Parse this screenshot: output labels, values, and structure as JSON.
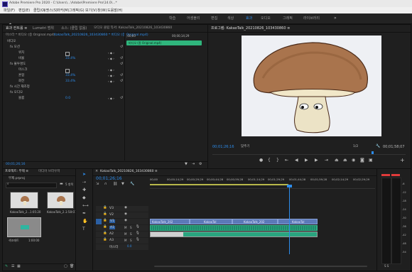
{
  "title_bar": {
    "text": "Adobe Premiere Pro 2020 - C:\\Users\\...\\Adobe\\Premiere Pro\\14.0\\...*"
  },
  "menu": [
    "파일(F)",
    "편집(E)",
    "클립(C)",
    "시퀀스(S)",
    "마커(M)",
    "그래픽(G)",
    "보기(V)",
    "창(W)",
    "도움말(H)"
  ],
  "workspaces": [
    "학습",
    "어셈블리",
    "편집",
    "색상",
    "효과",
    "오디오",
    "그래픽",
    "라이브러리"
  ],
  "effect_controls": {
    "tabs": [
      "효과 컨트롤 ≡",
      "Lumetri 범위",
      "소스: (클립 없음)",
      "오디오 클립 믹서: KakaoTalk_20210826_103430860"
    ],
    "source_label": "마스터 * 비디오 (종 Original.mp4)",
    "sequence_label": "KakaoTalk_20210826_103430860 * 비디오 (종 Original.mp4)",
    "timecode_start": ";00;00",
    "timecode_end": "00;00;14;29",
    "clip_name": "비디오 (종 Original.mp4)",
    "rows": [
      {
        "label": "비디오",
        "value": "",
        "kind": "section"
      },
      {
        "label": "fx 모션",
        "value": "",
        "kind": "group"
      },
      {
        "label": "위치",
        "value": "",
        "kind": "row"
      },
      {
        "label": "비율",
        "value": "33.4%",
        "kind": "row"
      },
      {
        "label": "fx 불투명도",
        "value": "",
        "kind": "group"
      },
      {
        "label": "마스크",
        "value": "",
        "kind": "row"
      },
      {
        "label": "혼합",
        "value": "33.4%",
        "kind": "row"
      },
      {
        "label": "회전",
        "value": "33.4%",
        "kind": "row"
      },
      {
        "label": "fx 시간 재조정",
        "value": "",
        "kind": "group"
      },
      {
        "label": "fx 오디오",
        "value": "",
        "kind": "group"
      },
      {
        "label": "볼륨",
        "value": "0.0",
        "kind": "row"
      }
    ],
    "bottom_time": "00;01;26;16"
  },
  "program_monitor": {
    "tab": "프로그램: KakaoTalk_20210826_103430860 ≡",
    "timecode": "00;01;26;16",
    "fit": "맞추기",
    "quality": "1/2",
    "duration": "00;01;58;07"
  },
  "project": {
    "tabs": [
      "프로젝트: 무제 ≡",
      "미디어 브라우저"
    ],
    "file": "무제.prproj",
    "item_count": "5 항목",
    "items": [
      {
        "name": "KakaoTalk_2...",
        "duration": "1:05:20"
      },
      {
        "name": "KakaoTalk_2...",
        "duration": "1:58:07"
      },
      {
        "name": "색조매트",
        "duration": "1:00:00"
      }
    ]
  },
  "timeline": {
    "tab": "KakaoTalk_20210826_103430860 ≡",
    "timecode": "00;01;26;16",
    "ruler": [
      "00;00",
      "00;00;14;29",
      "00;00;29;29",
      "00;00;44;28",
      "00;00;59;28",
      "00;01;14;29",
      "00;01;29;29",
      "00;01;44;28",
      "00;01;59;28",
      "00;02;14;29",
      "00;02;29;29"
    ],
    "tracks": [
      {
        "label": "V3",
        "kind": "video"
      },
      {
        "label": "V2",
        "kind": "video"
      },
      {
        "label": "V1",
        "kind": "video"
      },
      {
        "label": "A1",
        "kind": "audio"
      },
      {
        "label": "A2",
        "kind": "audio"
      },
      {
        "label": "A3",
        "kind": "audio"
      },
      {
        "label": "마스터",
        "kind": "master",
        "value": "0.0"
      }
    ],
    "clips": [
      "KakaoTalk_202",
      "KakaoTal",
      "KakaoTalk_202",
      "KakaoTal"
    ],
    "playhead_fraction": 0.586
  },
  "audio_meter": {
    "scale": [
      "-6",
      "-12",
      "-18",
      "-24",
      "-30",
      "-36",
      "-42",
      "-48",
      "-54"
    ],
    "footer": "S S"
  },
  "colors": {
    "accent": "#2d8ceb",
    "clip_video": "#5c79b8",
    "clip_audio": "#1f8a6a",
    "selection": "#2fb57c"
  }
}
